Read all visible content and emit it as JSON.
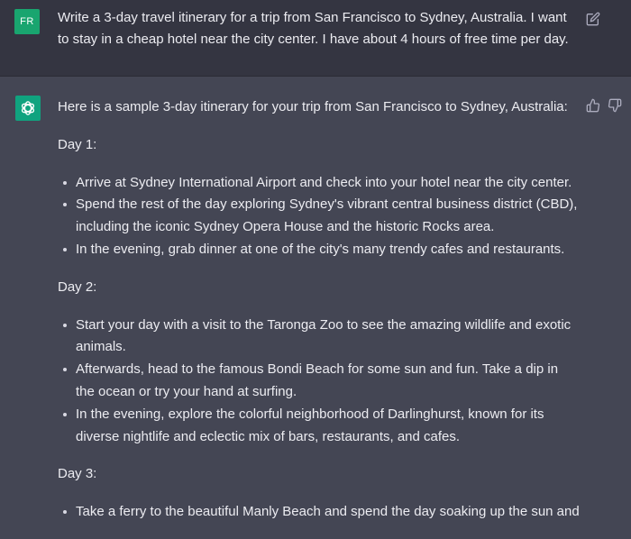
{
  "user_message": {
    "avatar_initials": "FR",
    "text": "Write a 3-day travel itinerary for a trip from San Francisco to Sydney, Australia. I want to stay in a cheap hotel near the city center. I have about 4 hours of free time per day."
  },
  "assistant_message": {
    "intro": "Here is a sample 3-day itinerary for your trip from San Francisco to Sydney, Australia:",
    "day1": {
      "heading": "Day 1:",
      "items": [
        "Arrive at Sydney International Airport and check into your hotel near the city center.",
        "Spend the rest of the day exploring Sydney's vibrant central business district (CBD), including the iconic Sydney Opera House and the historic Rocks area.",
        "In the evening, grab dinner at one of the city's many trendy cafes and restaurants."
      ]
    },
    "day2": {
      "heading": "Day 2:",
      "items": [
        "Start your day with a visit to the Taronga Zoo to see the amazing wildlife and exotic animals.",
        "Afterwards, head to the famous Bondi Beach for some sun and fun. Take a dip in the ocean or try your hand at surfing.",
        "In the evening, explore the colorful neighborhood of Darlinghurst, known for its diverse nightlife and eclectic mix of bars, restaurants, and cafes."
      ]
    },
    "day3": {
      "heading": "Day 3:",
      "items": [
        "Take a ferry to the beautiful Manly Beach and spend the day soaking up the sun and"
      ]
    }
  },
  "colors": {
    "user_bg": "#343541",
    "assistant_bg": "#444654",
    "user_avatar": "#19a56f",
    "assistant_avatar": "#10a37f",
    "text": "#ececf1"
  },
  "icons": [
    "edit-icon",
    "chatgpt-logo-icon",
    "thumbs-up-icon",
    "thumbs-down-icon"
  ]
}
